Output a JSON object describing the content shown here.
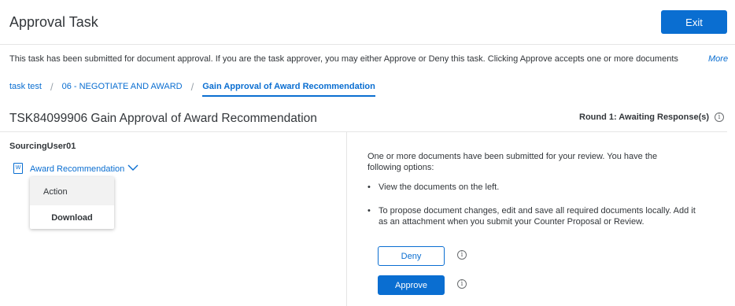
{
  "header": {
    "title": "Approval Task",
    "exit_label": "Exit"
  },
  "description": {
    "text": "This task has been submitted for document approval. If you are the task approver, you may either Approve or Deny this task. Clicking Approve accepts one or more documents",
    "more_label": "More"
  },
  "breadcrumb": {
    "items": [
      "task test",
      "06 - NEGOTIATE AND AWARD",
      "Gain Approval of Award Recommendation"
    ],
    "separator": "/"
  },
  "task": {
    "title": "TSK84099906 Gain Approval of Award Recommendation",
    "round_status": "Round 1: Awaiting Response(s)"
  },
  "left": {
    "user": "SourcingUser01",
    "document_name": "Award Recommendation",
    "menu": {
      "action_label": "Action",
      "download_label": "Download"
    }
  },
  "right": {
    "intro": "One or more documents have been submitted for your review. You have the following options:",
    "bullets": [
      "View the documents on the left.",
      "To propose document changes, edit and save all required documents locally. Add it as an attachment when you submit your Counter Proposal or Review."
    ],
    "deny_label": "Deny",
    "approve_label": "Approve"
  },
  "colors": {
    "accent": "#0a6ed1",
    "text": "#32363a",
    "divider": "#e5e5e5"
  },
  "icons": {
    "info": "info-icon",
    "document": "document-icon",
    "chevron": "chevron-down-icon"
  }
}
